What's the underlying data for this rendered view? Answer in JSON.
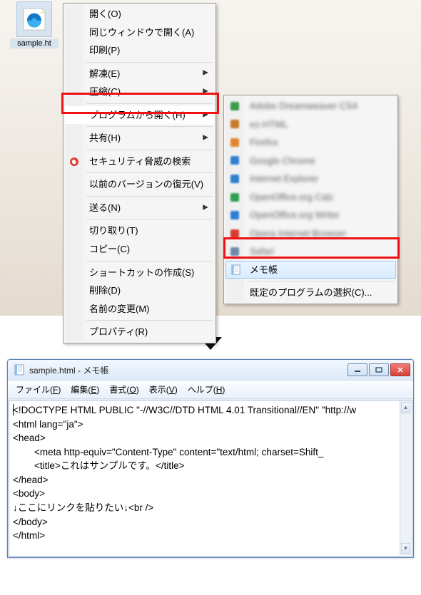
{
  "desktop": {
    "file_label": "sample.ht"
  },
  "context_menu": {
    "items": [
      {
        "label": "開く(O)"
      },
      {
        "label": "同じウィンドウで開く(A)"
      },
      {
        "label": "印刷(P)"
      },
      {
        "sep": true
      },
      {
        "label": "解凍(E)",
        "sub": true
      },
      {
        "label": "圧縮(C)",
        "sub": true
      },
      {
        "sep": true
      },
      {
        "label": "プログラムから開く(H)",
        "sub": true,
        "highlighted": true
      },
      {
        "sep": true
      },
      {
        "label": "共有(H)",
        "sub": true
      },
      {
        "sep": true
      },
      {
        "label": "セキュリティ脅威の検索",
        "icon": "trend-micro-icon"
      },
      {
        "sep": true
      },
      {
        "label": "以前のバージョンの復元(V)"
      },
      {
        "sep": true
      },
      {
        "label": "送る(N)",
        "sub": true
      },
      {
        "sep": true
      },
      {
        "label": "切り取り(T)"
      },
      {
        "label": "コピー(C)"
      },
      {
        "sep": true
      },
      {
        "label": "ショートカットの作成(S)"
      },
      {
        "label": "削除(D)"
      },
      {
        "label": "名前の変更(M)"
      },
      {
        "sep": true
      },
      {
        "label": "プロパティ(R)"
      }
    ]
  },
  "open_with_submenu": {
    "blurred_items": [
      {
        "label": "Adobe Dreamweaver CS4",
        "icon_color": "#3a9b4a"
      },
      {
        "label": "ez-HTML",
        "icon_color": "#c97a2b"
      },
      {
        "label": "Firefox",
        "icon_color": "#e0852e"
      },
      {
        "label": "Google Chrome",
        "icon_color": "#2f7fd1"
      },
      {
        "label": "Internet Explorer",
        "icon_color": "#2f7fd1"
      },
      {
        "label": "OpenOffice.org Calc",
        "icon_color": "#2f9f54"
      },
      {
        "label": "OpenOffice.org Writer",
        "icon_color": "#2f7fd1"
      },
      {
        "label": "Opera Internet Browser",
        "icon_color": "#d63a2f"
      },
      {
        "label": "Safari",
        "icon_color": "#6d8aa8"
      }
    ],
    "highlighted": {
      "label": "メモ帳",
      "icon": "notepad-icon"
    },
    "choose_default": "既定のプログラムの選択(C)..."
  },
  "notepad": {
    "title": "sample.html - メモ帳",
    "menus": {
      "file": "ファイル(F)",
      "edit": "編集(E)",
      "format": "書式(O)",
      "view": "表示(V)",
      "help": "ヘルプ(H)"
    },
    "content_lines": [
      "<!DOCTYPE HTML PUBLIC \"-//W3C//DTD HTML 4.01 Transitional//EN\" \"http://w",
      "<html lang=\"ja\">",
      "<head>",
      "        <meta http-equiv=\"Content-Type\" content=\"text/html; charset=Shift_",
      "        <title>これはサンプルです。</title>",
      "</head>",
      "<body>",
      "↓ここにリンクを貼りたい↓<br />",
      "</body>",
      "</html>"
    ]
  }
}
